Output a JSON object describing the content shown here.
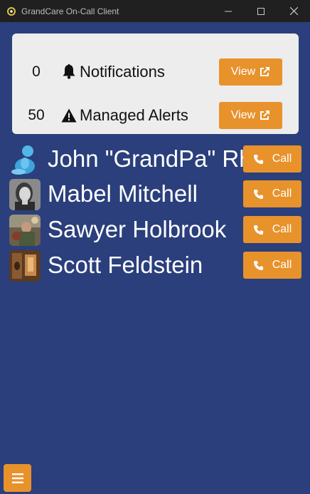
{
  "window": {
    "title": "GrandCare On-Call Client"
  },
  "summary": [
    {
      "count": "0",
      "label": "Notifications",
      "icon": "bell-icon",
      "button": "View"
    },
    {
      "count": "50",
      "label": "Managed Alerts",
      "icon": "warning-icon",
      "button": "View"
    }
  ],
  "contacts": [
    {
      "name": "John \"GrandPa\" Rhodes",
      "button": "Call",
      "avatar": "default-person-avatar"
    },
    {
      "name": "Mabel Mitchell",
      "button": "Call",
      "avatar": "photo-avatar"
    },
    {
      "name": "Sawyer Holbrook",
      "button": "Call",
      "avatar": "photo-avatar"
    },
    {
      "name": "Scott Feldstein",
      "button": "Call",
      "avatar": "photo-avatar"
    }
  ],
  "colors": {
    "background": "#2a3f7b",
    "accent": "#e8922c",
    "titlebar": "#202020"
  }
}
